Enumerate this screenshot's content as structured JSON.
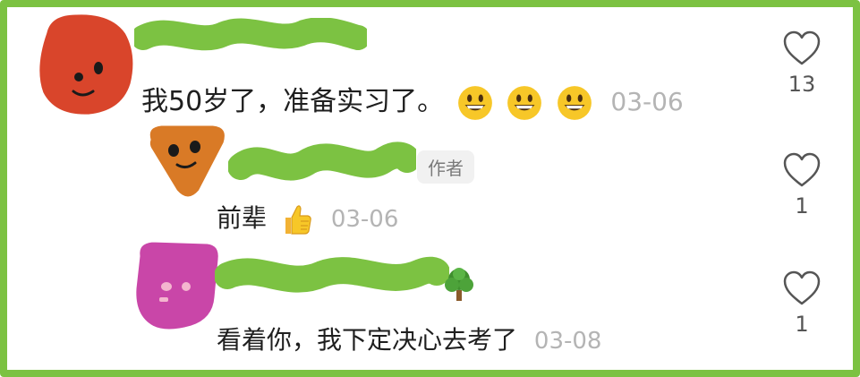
{
  "comments": [
    {
      "text": "我50岁了，准备实习了。",
      "emojis": [
        "grinning-face-emoji",
        "grinning-face-emoji",
        "grinning-face-emoji"
      ],
      "date": "03-06",
      "likes": "13",
      "avatar_color": "#d9452b"
    },
    {
      "badge": "作者",
      "text": "前辈",
      "emojis": [
        "thumbs-up-emoji"
      ],
      "date": "03-06",
      "likes": "1",
      "avatar_color": "#d97a26"
    },
    {
      "text": "看着你，我下定决心去考了",
      "name_suffix_icon": "tree-emoji",
      "date": "03-08",
      "likes": "1",
      "avatar_color": "#c946a8"
    }
  ],
  "colors": {
    "frame": "#7cc242",
    "name_blob": "#7cc242",
    "date": "#b4b4b4",
    "heart_outline": "#555555"
  }
}
